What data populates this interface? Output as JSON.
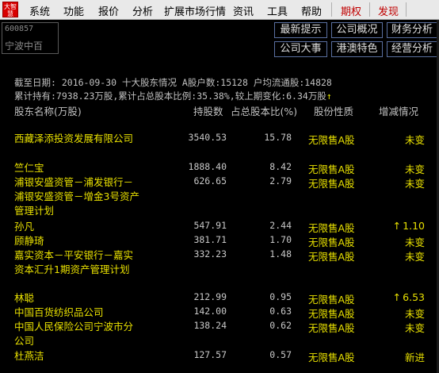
{
  "app": {
    "logo_text": "大智慧"
  },
  "menu": {
    "items": [
      "系统",
      "功能",
      "报价",
      "分析",
      "扩展市场行情",
      "资讯",
      "工具",
      "帮助"
    ],
    "special": [
      "期权",
      "发现"
    ]
  },
  "stock": {
    "code": "600857",
    "name": "宁波中百"
  },
  "buttons": {
    "row1": [
      "最新提示",
      "公司概况",
      "财务分析"
    ],
    "row2": [
      "公司大事",
      "港澳特色",
      "经营分析"
    ]
  },
  "summary": {
    "line1": "截至日期: 2016-09-30 十大股东情况 A股户数:15128 户均流通股:14828",
    "line2": "累计持有:7938.23万股,累计占总股本比例:35.38%,较上期变化:6.34万股"
  },
  "table": {
    "headers": {
      "name": "股东名称(万股)",
      "hold": "持股数",
      "pct": "占总股本比(%)",
      "type": "股份性质",
      "change": "增减情况"
    },
    "rows": [
      {
        "name": "西藏泽添投资发展有限公司",
        "hold": "3540.53",
        "pct": "15.78",
        "type": "无限售A股",
        "change": "未变",
        "up": false
      },
      {
        "name": "竺仁宝",
        "hold": "1888.40",
        "pct": "8.42",
        "type": "无限售A股",
        "change": "未变",
        "up": false
      },
      {
        "name": "浦银安盛资管－浦发银行－浦银安盛资管－增金3号资产管理计划",
        "hold": "626.65",
        "pct": "2.79",
        "type": "无限售A股",
        "change": "未变",
        "up": false
      },
      {
        "name": "孙凡",
        "hold": "547.91",
        "pct": "2.44",
        "type": "无限售A股",
        "change": "1.10",
        "up": true
      },
      {
        "name": "顾静琦",
        "hold": "381.71",
        "pct": "1.70",
        "type": "无限售A股",
        "change": "未变",
        "up": false
      },
      {
        "name": "嘉实资本－平安银行－嘉实资本汇升1期资产管理计划",
        "hold": "332.23",
        "pct": "1.48",
        "type": "无限售A股",
        "change": "未变",
        "up": false
      },
      {
        "name": "林聪",
        "hold": "212.99",
        "pct": "0.95",
        "type": "无限售A股",
        "change": "6.53",
        "up": true
      },
      {
        "name": "中国百货纺织品公司",
        "hold": "142.00",
        "pct": "0.63",
        "type": "无限售A股",
        "change": "未变",
        "up": false
      },
      {
        "name": "中国人民保险公司宁波市分公司",
        "hold": "138.24",
        "pct": "0.62",
        "type": "无限售A股",
        "change": "未变",
        "up": false
      },
      {
        "name": "杜燕洁",
        "hold": "127.57",
        "pct": "0.57",
        "type": "无限售A股",
        "change": "新进",
        "up": false
      }
    ]
  }
}
